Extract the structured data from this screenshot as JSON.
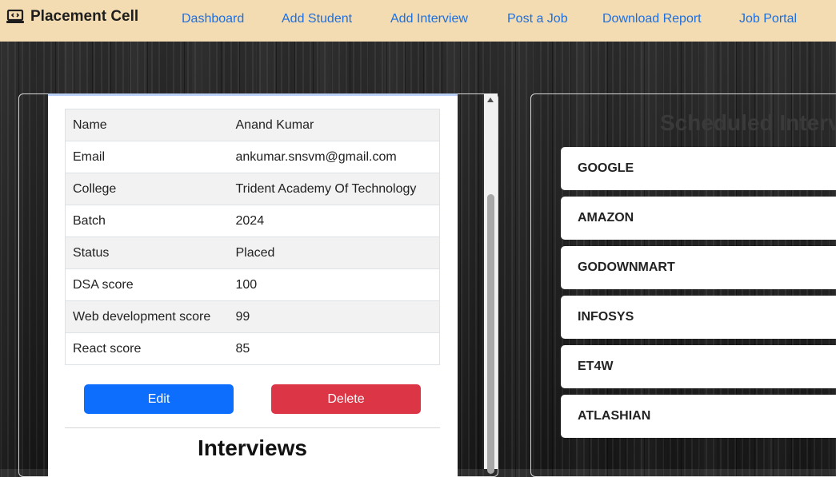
{
  "navbar": {
    "brand": "Placement Cell",
    "brand_icon": "laptop-code-icon",
    "links": [
      "Dashboard",
      "Add Student",
      "Add Interview",
      "Post a Job",
      "Download Report",
      "Job Portal"
    ]
  },
  "student": {
    "rows": [
      {
        "label": "Name",
        "value": "Anand Kumar"
      },
      {
        "label": "Email",
        "value": "ankumar.snsvm@gmail.com"
      },
      {
        "label": "College",
        "value": "Trident Academy Of Technology"
      },
      {
        "label": "Batch",
        "value": "2024"
      },
      {
        "label": "Status",
        "value": "Placed"
      },
      {
        "label": "DSA score",
        "value": "100"
      },
      {
        "label": "Web development score",
        "value": "99"
      },
      {
        "label": "React score",
        "value": "85"
      }
    ],
    "edit_label": "Edit",
    "delete_label": "Delete",
    "interviews_heading": "Interviews"
  },
  "right_panel": {
    "heading": "Scheduled Interv",
    "companies": [
      "GOOGLE",
      "AMAZON",
      "GODOWNMART",
      "INFOSYS",
      "ET4W",
      "ATLASHIAN"
    ]
  },
  "colors": {
    "navbar_bg": "#f4dcb2",
    "link": "#1d6fe0",
    "edit_button": "#0d6efd",
    "delete_button": "#dc3545"
  }
}
